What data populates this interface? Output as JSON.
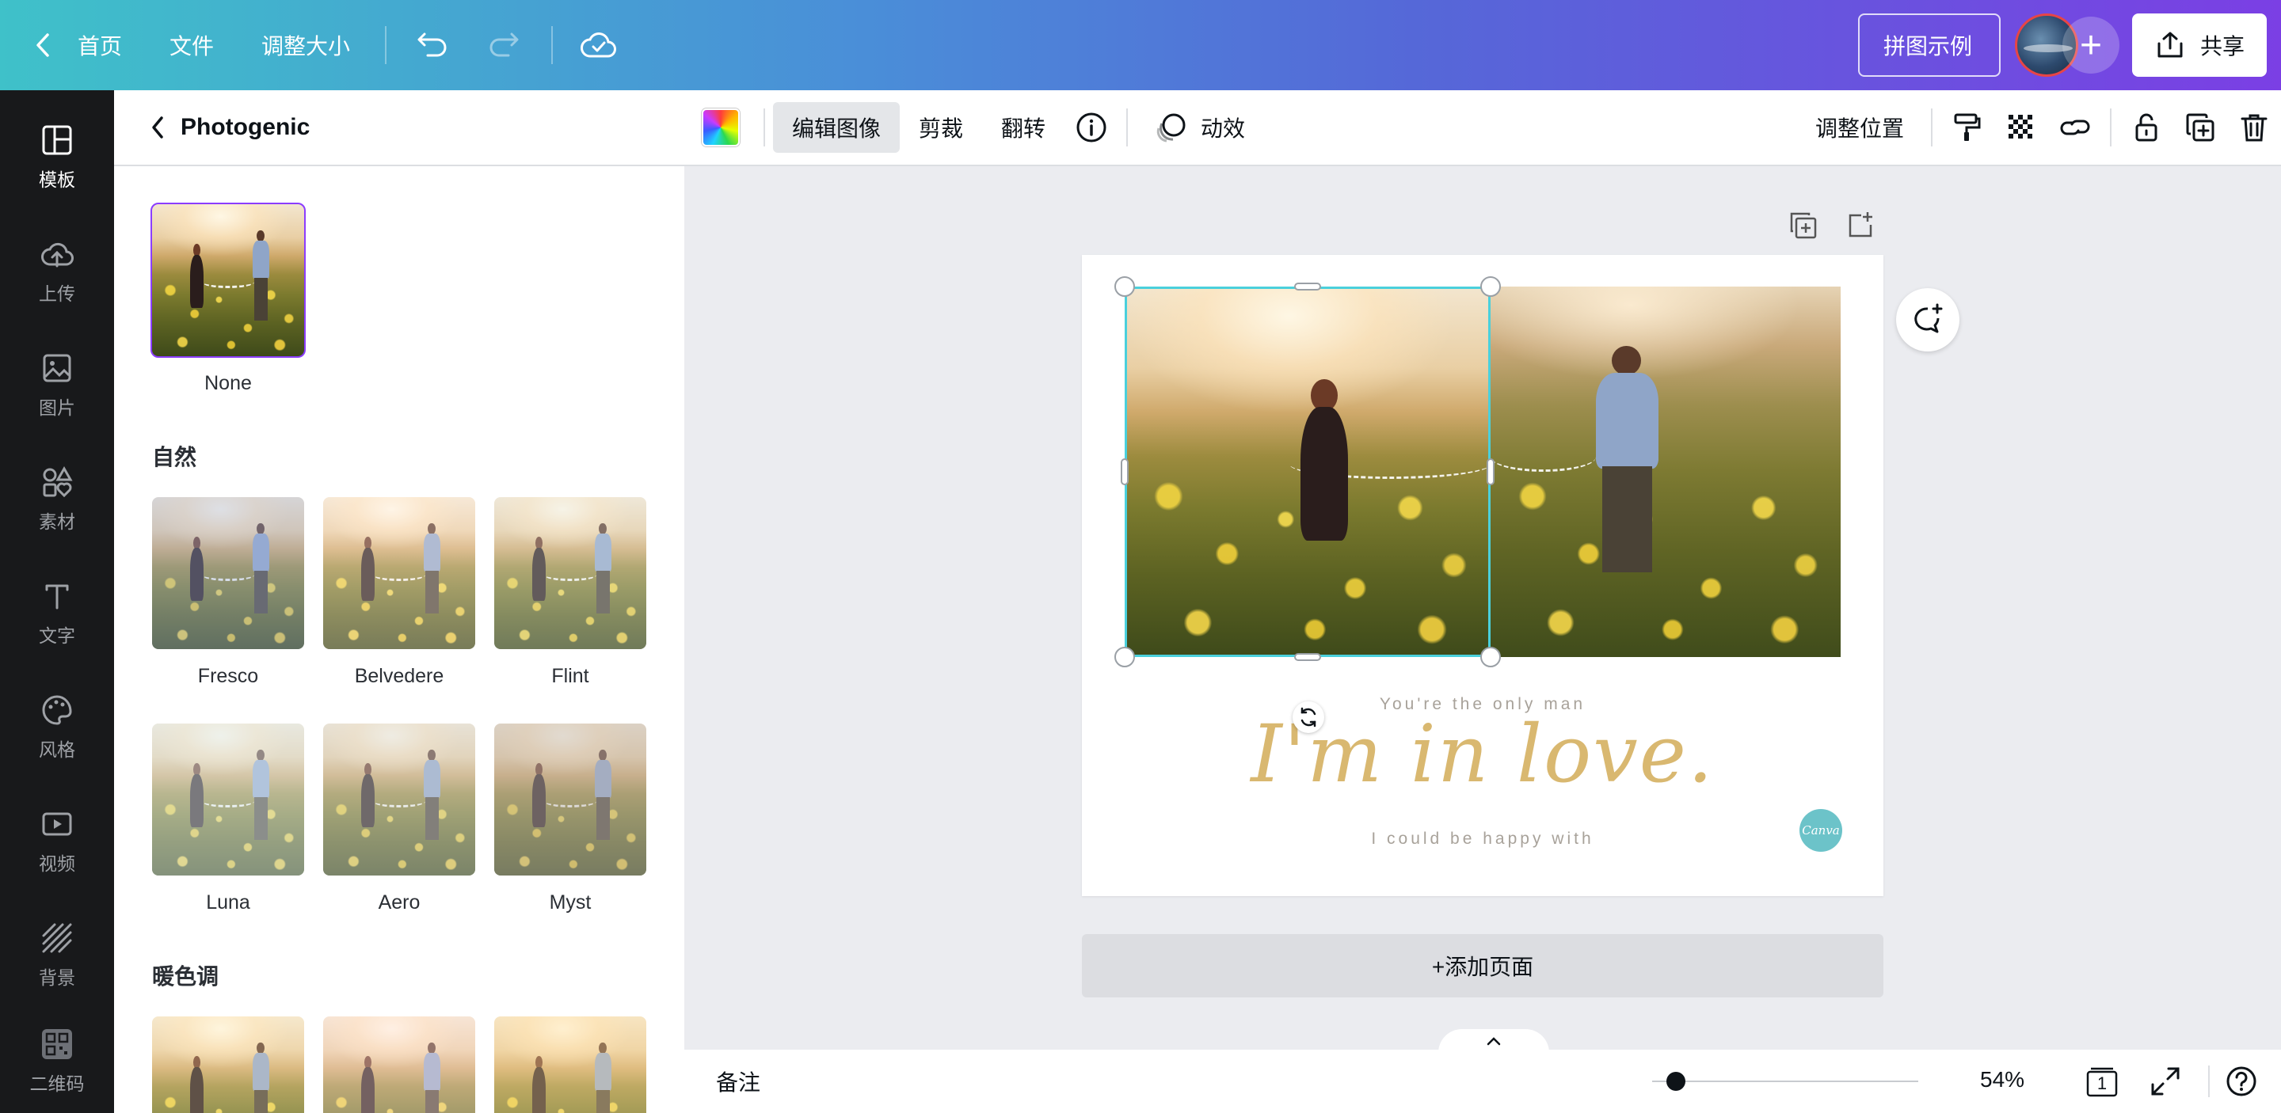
{
  "topbar": {
    "home": "首页",
    "file": "文件",
    "resize": "调整大小",
    "design_title": "拼图示例",
    "share": "共享"
  },
  "rail": {
    "items": [
      {
        "label": "模板",
        "icon": "template-icon"
      },
      {
        "label": "上传",
        "icon": "upload-icon"
      },
      {
        "label": "图片",
        "icon": "photo-icon"
      },
      {
        "label": "素材",
        "icon": "elements-icon"
      },
      {
        "label": "文字",
        "icon": "text-icon"
      },
      {
        "label": "风格",
        "icon": "palette-icon"
      },
      {
        "label": "视频",
        "icon": "video-icon"
      },
      {
        "label": "背景",
        "icon": "background-icon"
      },
      {
        "label": "二维码",
        "icon": "qr-code-icon"
      }
    ]
  },
  "panel": {
    "title": "Photogenic",
    "none_label": "None",
    "section_natural": "自然",
    "section_warm": "暖色调",
    "filters": [
      {
        "label": "Fresco"
      },
      {
        "label": "Belvedere"
      },
      {
        "label": "Flint"
      },
      {
        "label": "Luna"
      },
      {
        "label": "Aero"
      },
      {
        "label": "Myst"
      }
    ]
  },
  "toolbar": {
    "edit_image": "编辑图像",
    "crop": "剪裁",
    "flip": "翻转",
    "animate": "动效",
    "position": "调整位置"
  },
  "canvas": {
    "line1": "You're the only man",
    "script": "I'm in love.",
    "line2": "I could be happy with",
    "badge": "Canva",
    "add_page": "+添加页面"
  },
  "bottombar": {
    "notes": "备注",
    "zoom": "54%",
    "page_count": "1"
  },
  "colors": {
    "accent": "#8b3dff",
    "selection": "#4ad0dc",
    "script_gold": "#d9b870"
  }
}
